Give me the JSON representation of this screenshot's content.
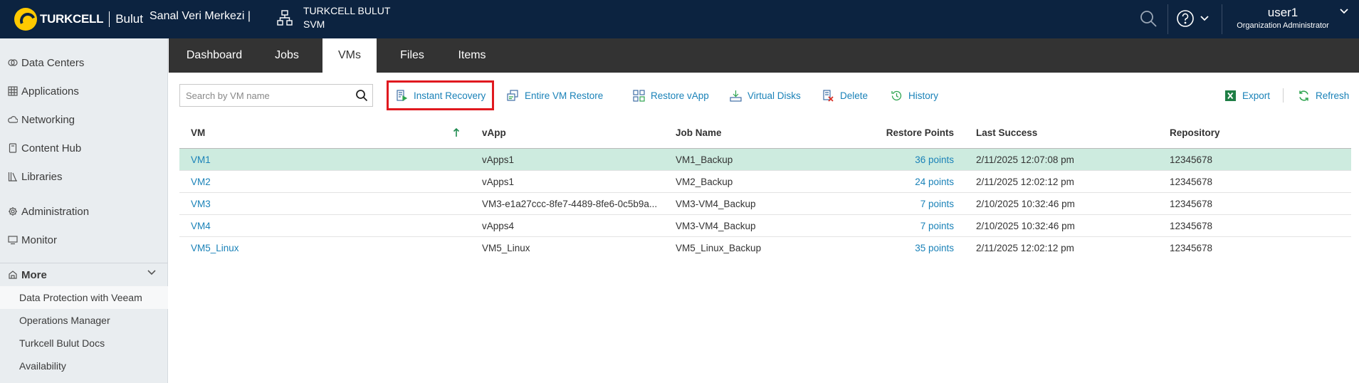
{
  "header": {
    "brand": "TURKCELL",
    "brand_sub": "Bulut",
    "org_name": "Sanal Veri Merkezi |",
    "site_line1": "TURKCELL BULUT",
    "site_line2": "SVM",
    "user_name": "user1",
    "user_role": "Organization Administrator"
  },
  "sidebar": {
    "items": [
      {
        "label": "Data Centers",
        "icon": "data-centers-icon"
      },
      {
        "label": "Applications",
        "icon": "applications-icon"
      },
      {
        "label": "Networking",
        "icon": "networking-icon"
      },
      {
        "label": "Content Hub",
        "icon": "content-hub-icon"
      },
      {
        "label": "Libraries",
        "icon": "libraries-icon"
      },
      {
        "label": "Administration",
        "icon": "gear-icon"
      },
      {
        "label": "Monitor",
        "icon": "monitor-icon"
      }
    ],
    "more_label": "More",
    "more_items": [
      {
        "label": "Data Protection with Veeam"
      },
      {
        "label": "Operations Manager"
      },
      {
        "label": "Turkcell Bulut Docs"
      },
      {
        "label": "Availability"
      }
    ]
  },
  "tabs": [
    {
      "label": "Dashboard"
    },
    {
      "label": "Jobs"
    },
    {
      "label": "VMs"
    },
    {
      "label": "Files"
    },
    {
      "label": "Items"
    }
  ],
  "toolbar": {
    "search_placeholder": "Search by VM name",
    "instant_recovery": "Instant Recovery",
    "entire_vm_restore": "Entire VM Restore",
    "restore_vapp": "Restore vApp",
    "virtual_disks": "Virtual Disks",
    "delete": "Delete",
    "history": "History",
    "export": "Export",
    "refresh": "Refresh"
  },
  "table": {
    "columns": {
      "vm": "VM",
      "vapp": "vApp",
      "job_name": "Job Name",
      "restore_points": "Restore Points",
      "last_success": "Last Success",
      "repository": "Repository"
    },
    "rows": [
      {
        "vm": "VM1",
        "vapp": "vApps1",
        "job": "VM1_Backup",
        "points": "36 points",
        "last": "2/11/2025 12:07:08 pm",
        "repo": "12345678"
      },
      {
        "vm": "VM2",
        "vapp": "vApps1",
        "job": "VM2_Backup",
        "points": "24 points",
        "last": "2/11/2025 12:02:12 pm",
        "repo": "12345678"
      },
      {
        "vm": "VM3",
        "vapp": "VM3-e1a27ccc-8fe7-4489-8fe6-0c5b9a...",
        "job": "VM3-VM4_Backup",
        "points": "7 points",
        "last": "2/10/2025 10:32:46 pm",
        "repo": "12345678"
      },
      {
        "vm": "VM4",
        "vapp": "vApps4",
        "job": "VM3-VM4_Backup",
        "points": "7 points",
        "last": "2/10/2025 10:32:46 pm",
        "repo": "12345678"
      },
      {
        "vm": "VM5_Linux",
        "vapp": "VM5_Linux",
        "job": "VM5_Linux_Backup",
        "points": "35 points",
        "last": "2/11/2025 12:02:12 pm",
        "repo": "12345678"
      }
    ]
  },
  "colors": {
    "header_bg": "#0c2340",
    "tabbar_bg": "#333333",
    "link": "#1a82b8",
    "selected_row": "#cdebdf",
    "highlight": "#e0191f"
  }
}
